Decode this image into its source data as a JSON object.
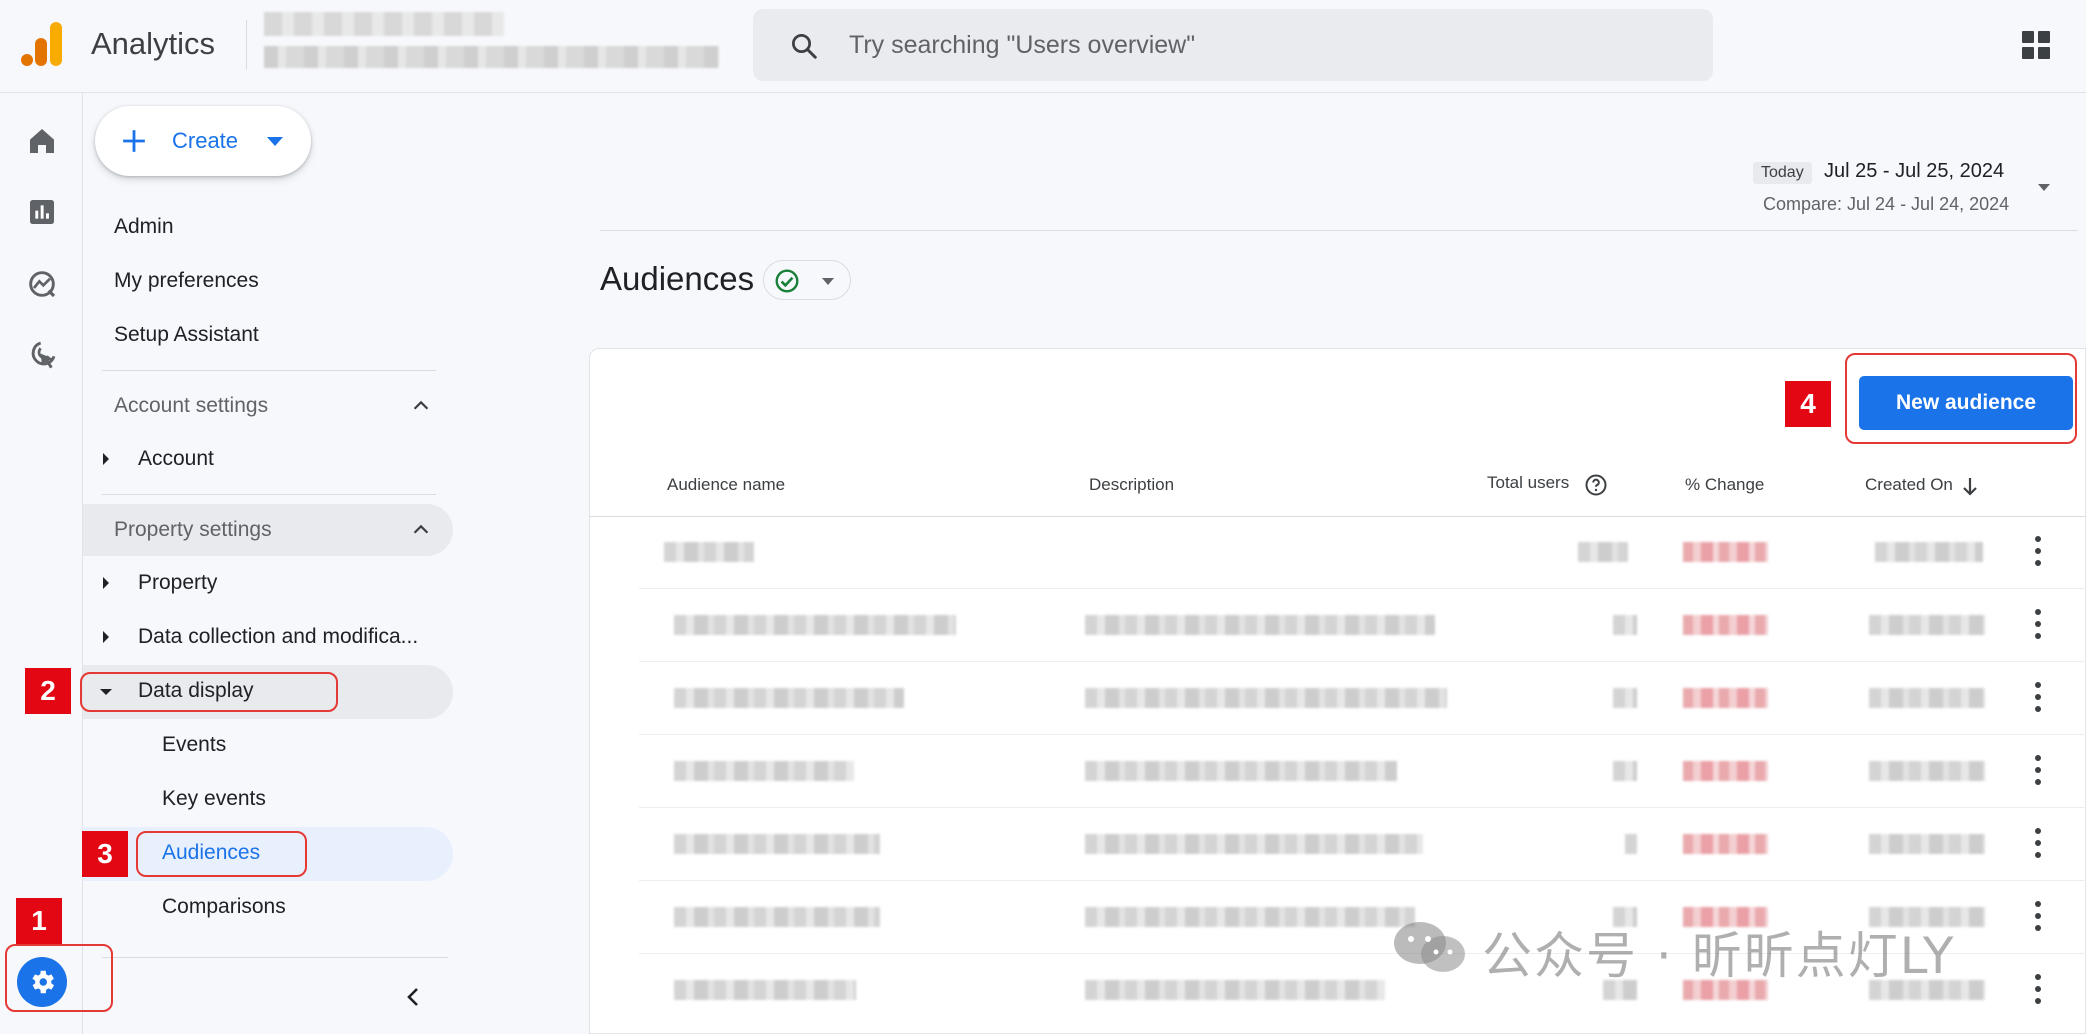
{
  "topbar": {
    "app_title": "Analytics",
    "search_placeholder": "Try searching \"Users overview\""
  },
  "sidebar": {
    "create_label": "Create",
    "items": {
      "admin": "Admin",
      "my_preferences": "My preferences",
      "setup_assistant": "Setup Assistant",
      "account_settings": "Account settings",
      "account": "Account",
      "property_settings": "Property settings",
      "property": "Property",
      "data_collection": "Data collection and modifica...",
      "data_display": "Data display",
      "events": "Events",
      "key_events": "Key events",
      "audiences": "Audiences",
      "comparisons": "Comparisons"
    }
  },
  "date": {
    "today_chip": "Today",
    "range": "Jul 25 - Jul 25, 2024",
    "compare": "Compare: Jul 24 - Jul 24, 2024"
  },
  "main": {
    "title": "Audiences",
    "new_audience_label": "New audience",
    "columns": [
      "Audience name",
      "Description",
      "Total users",
      "% Change",
      "Created On"
    ]
  },
  "annotations": {
    "badges": [
      "1",
      "2",
      "3",
      "4"
    ]
  },
  "watermark": "公众号 · 昕昕点灯LY",
  "colors": {
    "accent": "#1a73e8",
    "annotation_red": "#e30613",
    "status_ok": "#188038"
  }
}
